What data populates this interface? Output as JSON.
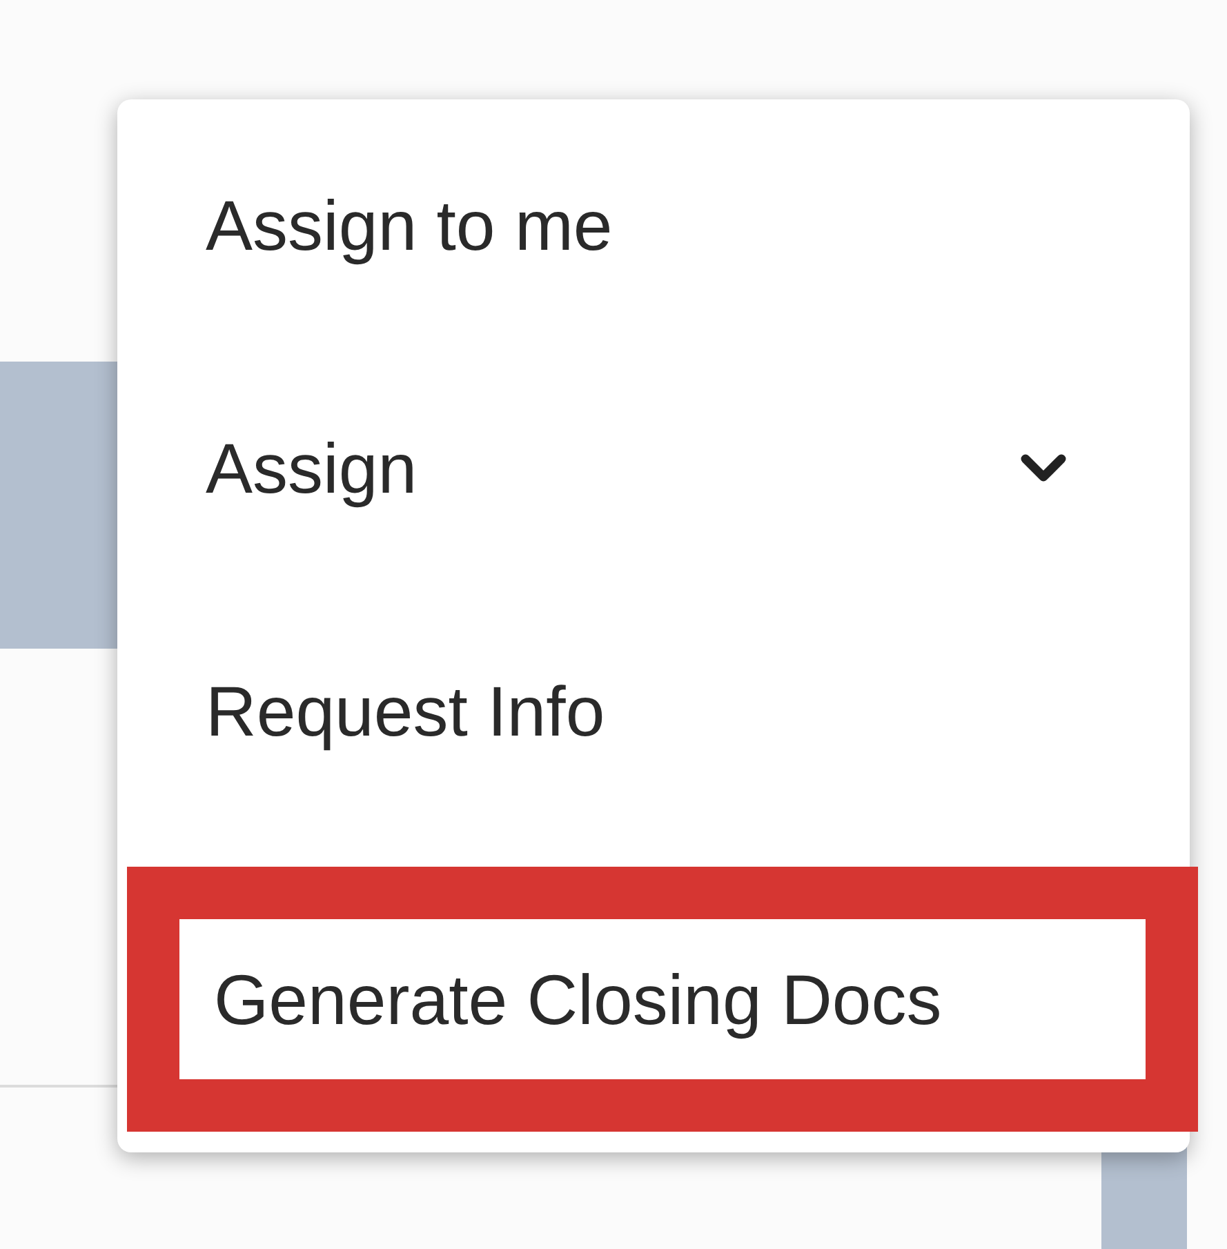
{
  "menu": {
    "items": [
      {
        "label": "Assign to me",
        "kind": "action",
        "highlighted": false
      },
      {
        "label": "Assign",
        "kind": "submenu",
        "highlighted": false
      },
      {
        "label": "Request Info",
        "kind": "action",
        "highlighted": false
      },
      {
        "label": "Generate Closing Docs",
        "kind": "action",
        "highlighted": true
      }
    ]
  }
}
